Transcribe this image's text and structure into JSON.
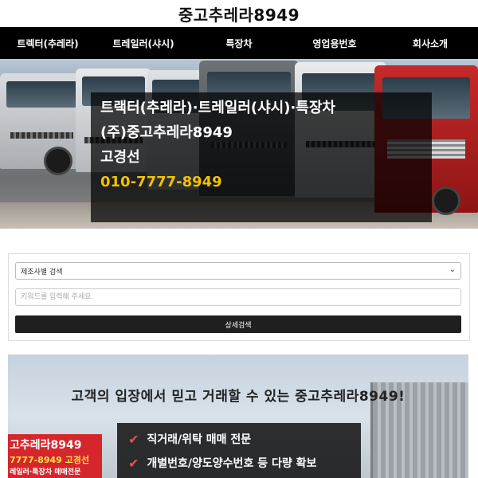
{
  "header": {
    "site_title": "중고추레라8949"
  },
  "nav": {
    "items": [
      {
        "label": "트렉터(추레라)"
      },
      {
        "label": "트레일러(샤시)"
      },
      {
        "label": "특장차"
      },
      {
        "label": "영업용번호"
      },
      {
        "label": "회사소개"
      }
    ]
  },
  "hero": {
    "line1": "트랙터(추레라)·트레일러(샤시)·특장차",
    "line2": "(주)중고추레라8949",
    "line3": "고경선",
    "phone": "010-7777-8949",
    "phone_color": "#f2c200"
  },
  "search": {
    "select_value": "제조사별 검색",
    "keyword_placeholder": "키워드를 입력해 주세요.",
    "button_label": "상세검색"
  },
  "promo": {
    "headline": "고객의 입장에서 믿고 거래할 수 있는 중고추레라8949!",
    "sign_line1": "고추레라8949",
    "sign_line2": "7777-8949 고경선",
    "sign_line3": "레일러·특장차 매매전문",
    "features": [
      {
        "text": "직거래/위탁 매매 전문"
      },
      {
        "text": "개별번호/양도양수번호 등 다량 확보"
      }
    ],
    "check_color": "#f04e4e"
  }
}
